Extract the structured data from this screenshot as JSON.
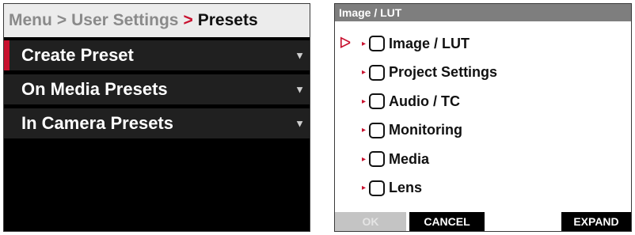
{
  "left_menu": {
    "breadcrumb": {
      "items": [
        "Menu",
        "User Settings"
      ],
      "separator": ">",
      "current": "Presets"
    },
    "items": [
      {
        "label": "Create Preset",
        "selected": true
      },
      {
        "label": "On Media Presets",
        "selected": false
      },
      {
        "label": "In Camera Presets",
        "selected": false
      }
    ],
    "chevron_glyph": "▼"
  },
  "dialog": {
    "title": "Image / LUT",
    "pointer_glyph": "ᐅ",
    "arrow_glyph": "▸",
    "options": [
      {
        "label": "Image / LUT",
        "checked": false,
        "focused": true
      },
      {
        "label": "Project Settings",
        "checked": false,
        "focused": false
      },
      {
        "label": "Audio / TC",
        "checked": false,
        "focused": false
      },
      {
        "label": "Monitoring",
        "checked": false,
        "focused": false
      },
      {
        "label": "Media",
        "checked": false,
        "focused": false
      },
      {
        "label": "Lens",
        "checked": false,
        "focused": false
      }
    ],
    "buttons": {
      "ok": "OK",
      "cancel": "CANCEL",
      "expand": "EXPAND"
    }
  },
  "colors": {
    "accent_red": "#c8102e",
    "title_bar_gray": "#7e7e7e",
    "disabled_button_gray": "#c4c4c4"
  }
}
